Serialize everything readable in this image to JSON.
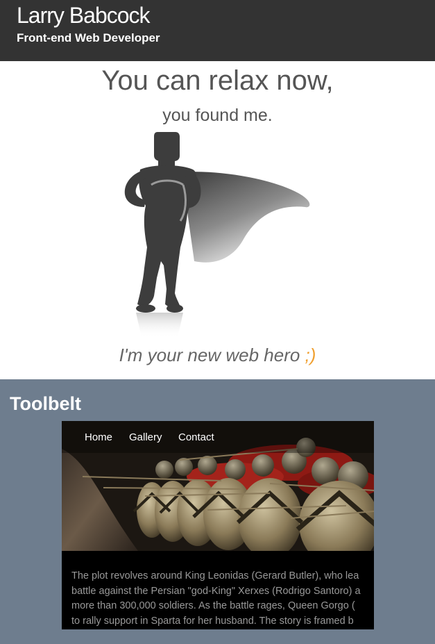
{
  "header": {
    "name": "Larry Babcock",
    "tagline": "Front-end Web Developer"
  },
  "hero": {
    "heading": "You can relax now,",
    "subheading": "you found me.",
    "footer_text": "I'm your new web hero",
    "footer_wink": ";)"
  },
  "toolbelt": {
    "title": "Toolbelt",
    "nav": [
      "Home",
      "Gallery",
      "Contact"
    ],
    "text_lines": [
      "The plot revolves around King Leonidas (Gerard Butler), who lea",
      "battle against the Persian \"god-King\" Xerxes (Rodrigo Santoro) a",
      "more than 300,000 soldiers. As the battle rages, Queen Gorgo (",
      "to rally support in Sparta for her husband. The story is framed b"
    ]
  },
  "colors": {
    "header_bg": "#333333",
    "toolbelt_bg": "#6e7d8e",
    "accent": "#f0a030"
  },
  "icons": {
    "hero_figure": "superhero-silhouette-icon"
  }
}
